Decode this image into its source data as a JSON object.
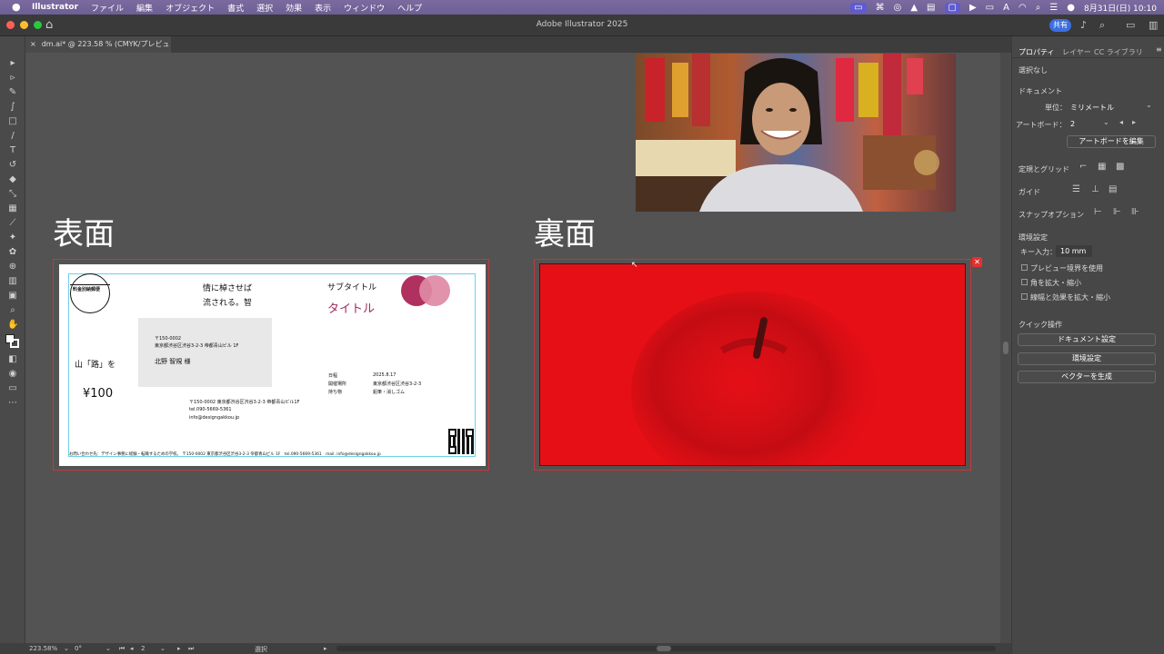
{
  "menubar": {
    "app": "Illustrator",
    "items": [
      "ファイル",
      "編集",
      "オブジェクト",
      "書式",
      "選択",
      "効果",
      "表示",
      "ウィンドウ",
      "ヘルプ"
    ],
    "clock": "8月31日(日) 10:10"
  },
  "window": {
    "title": "Adobe Illustrator 2025",
    "share_label": "共有"
  },
  "document_tab": {
    "close": "×",
    "label": "dm.ai* @ 223.58 % (CMYK/プレビュー)"
  },
  "canvas": {
    "front_heading": "表面",
    "back_heading": "裏面",
    "front": {
      "stamp": "料金別納郵便",
      "poem_line1": "情に棹させば",
      "poem_line2": "流される。智",
      "subtitle": "サブタイトル",
      "title": "タイトル",
      "address_zip": "〒150-0002",
      "address_line": "東京都渋谷区渋谷3-2-3 帝都青山ビル 1F",
      "recipient": "北野 智規 様",
      "left_text": "山「路」を",
      "price": "¥100",
      "sender_line1": "〒150-0002 東京都渋谷区渋谷3-2-3 帝都青山ビル1F",
      "sender_line2": "tel.090-5669-5361",
      "sender_line3": "info@designgakkou.jp",
      "info_label1": "日程",
      "info_value1": "2025.8.17",
      "info_label2": "開催場所",
      "info_value2": "東京都渋谷区渋谷3-2-3",
      "info_label3": "持ち物",
      "info_value3": "鉛筆・消しゴム",
      "footer": "お問い合わせ先：デザイン事務に経験・転職するための学校。 〒150-0002 東京都渋谷区渋谷3-2-3 帝都青山ビル 1F　tel.090-5669-5361　mail. info@designgakkou.jp"
    },
    "colors": {
      "back_red": "#e60f16",
      "circle_dark": "#b03060",
      "circle_light": "#dd8aa4",
      "title_color": "#9a2a5a"
    }
  },
  "panel": {
    "tabs": [
      "プロパティ",
      "レイヤー",
      "CC ライブラリ"
    ],
    "selection": "選択なし",
    "document_section": "ドキュメント",
    "unit_label": "単位：",
    "unit_value": "ミリメートル",
    "artboard_label": "アートボード：",
    "artboard_value": "2",
    "edit_artboard_button": "アートボードを編集",
    "rulers_grid": "定規とグリッド",
    "guides": "ガイド",
    "snap_options": "スナップオプション",
    "preferences_section": "環境設定",
    "key_input_label": "キー入力：",
    "key_input_value": "10 mm",
    "preview_bounds": "プレビュー境界を使用",
    "scale_corners": "角を拡大・縮小",
    "scale_strokes": "線幅と効果を拡大・縮小",
    "quick_actions": "クイック操作",
    "doc_setup_button": "ドキュメント設定",
    "prefs_button": "環境設定",
    "vector_button": "ベクターを生成"
  },
  "statusbar": {
    "zoom": "223.58%",
    "rotation": "0°",
    "artboard": "2",
    "mode": "選択"
  }
}
